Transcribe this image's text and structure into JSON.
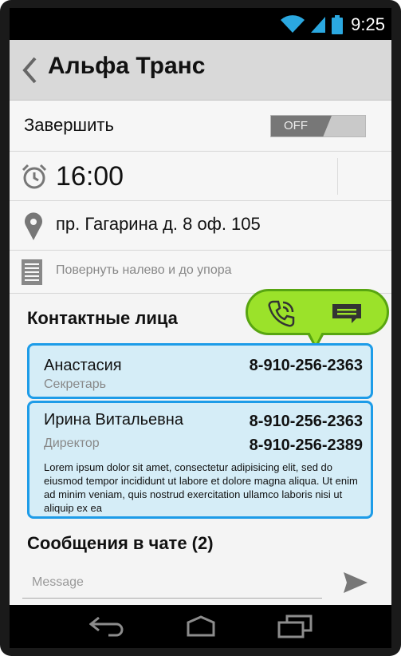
{
  "status_bar": {
    "time": "9:25",
    "icons": [
      "wifi-icon",
      "signal-icon",
      "battery-icon"
    ]
  },
  "header": {
    "title": "Альфа Транс",
    "back_icon": "chevron-left-icon"
  },
  "finish": {
    "label": "Завершить",
    "toggle_state": "OFF"
  },
  "schedule": {
    "time": "16:00",
    "icon": "clock-icon"
  },
  "address": {
    "text": "пр. Гагарина д. 8 оф. 105",
    "icon": "map-pin-icon"
  },
  "note": {
    "text": "Повернуть налево и до упора",
    "icon": "document-icon"
  },
  "contacts": {
    "title": "Контактные лица",
    "action_icons": [
      "phone-icon",
      "message-icon"
    ],
    "items": [
      {
        "name": "Анастасия",
        "role": "Секретарь",
        "phones": [
          "8-910-256-2363"
        ]
      },
      {
        "name": "Ирина Витальевна",
        "role": "Директор",
        "phones": [
          "8-910-256-2363",
          "8-910-256-2389"
        ],
        "description": "Lorem ipsum dolor sit amet, consectetur adipisicing elit, sed do eiusmod tempor incididunt ut labore et dolore magna aliqua. Ut enim ad minim veniam, quis nostrud exercitation ullamco laboris nisi ut aliquip ex ea"
      }
    ]
  },
  "chat": {
    "title": "Сообщения в чате (2)",
    "input_placeholder": "Message",
    "input_value": "",
    "send_icon": "send-icon"
  },
  "nav_bar": {
    "icons": [
      "back-icon",
      "home-icon",
      "recent-apps-icon"
    ]
  },
  "colors": {
    "accent_blue": "#1d9ce8",
    "card_bg": "#d5edf7",
    "bubble_green": "#9be22a",
    "bubble_border": "#58a511",
    "actionbar_bg": "#d9d9d9"
  }
}
